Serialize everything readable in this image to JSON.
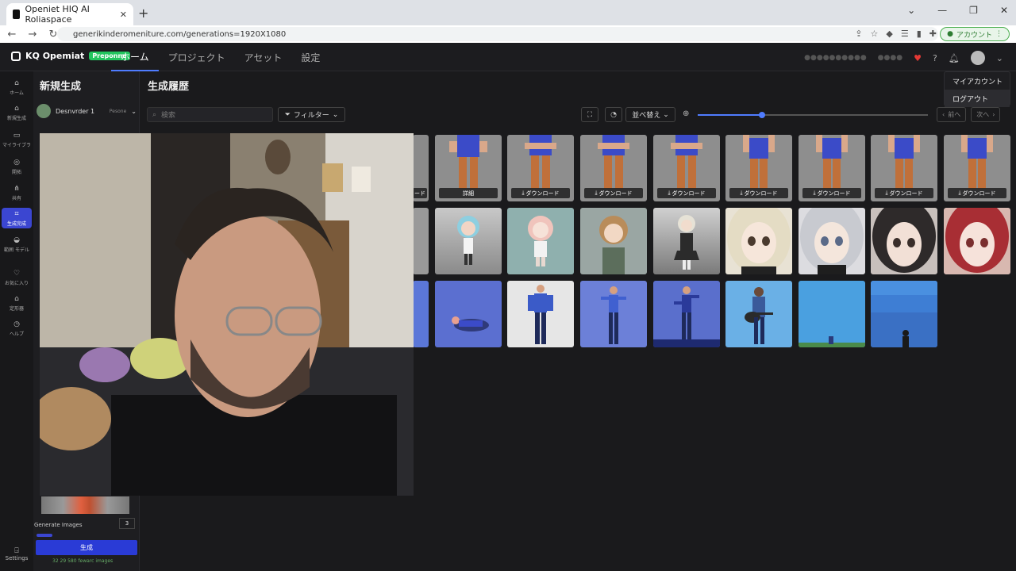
{
  "browser": {
    "tab_title": "Openiet HIQ AI Roliaspace",
    "url": "generikinderomeniture.com/generations=1920X1080",
    "profile_label": "アカウント"
  },
  "app": {
    "brand": "KQ Opemiat",
    "badge": "Preponne",
    "nav": [
      "ホーム",
      "プロジェクト",
      "アセット",
      "設定"
    ],
    "active_nav": "ホーム"
  },
  "rail": {
    "items": [
      {
        "label": "ホーム",
        "icon": "home-icon"
      },
      {
        "label": "新規生成",
        "icon": "home-icon"
      },
      {
        "label": "マイライブラ",
        "icon": "folder-icon"
      },
      {
        "label": "開拓",
        "icon": "compass-icon"
      },
      {
        "label": "共有",
        "icon": "share-icon"
      },
      {
        "label": "生成完成",
        "icon": "generate-icon"
      },
      {
        "label": "範囲 モデル",
        "icon": "model-icon"
      },
      {
        "label": "お気に入り",
        "icon": "heart-icon"
      },
      {
        "label": "定形器",
        "icon": "archive-icon"
      },
      {
        "label": "ヘルプ",
        "icon": "help-icon"
      }
    ],
    "settings_label": "Settings"
  },
  "panel": {
    "title": "新規生成",
    "user_name": "Desnvrder 1",
    "user_tag": "Pesone",
    "generate_images_label": "Generate Images",
    "generate_count": "3",
    "generate_button": "生成",
    "credits": "32 29 580 fewarc images"
  },
  "main": {
    "title": "生成履歴",
    "search_placeholder": "検索",
    "filter_label": "フィルター",
    "sort_label": "並べ替え",
    "zoom_level": 0.28,
    "prev_label": "前へ",
    "next_label": "次へ"
  },
  "account_menu": {
    "items": [
      "マイアカウント",
      "ログアウト"
    ]
  },
  "gallery": {
    "row1_labels": [
      "ード",
      "詳細",
      "ダウンロード",
      "ダウンロード",
      "ダウンロード",
      "ダウンロード",
      "ダウンロード",
      "ダウンロード",
      "ダウンロード"
    ],
    "download_icon": "download-icon"
  },
  "colors": {
    "accent": "#3b46d1",
    "brand_badge": "#22c55e",
    "background": "#1a1a1c"
  }
}
